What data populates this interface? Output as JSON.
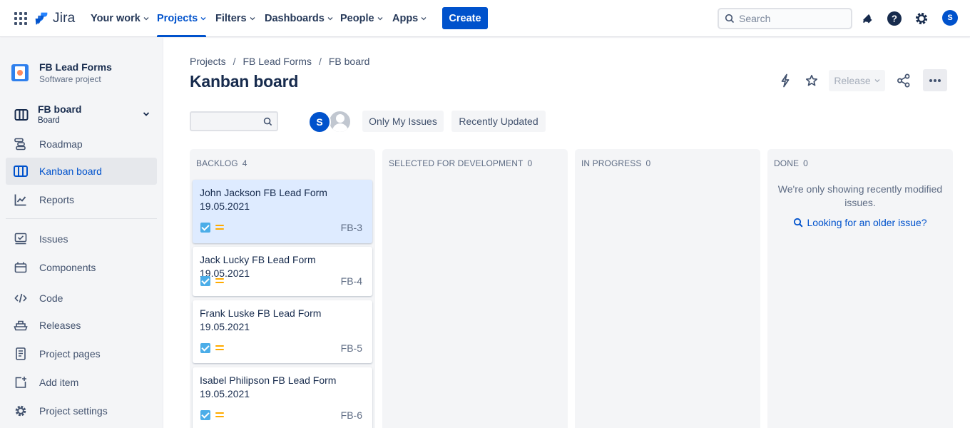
{
  "topnav": {
    "logo_text": "Jira",
    "items": [
      {
        "label": "Your work"
      },
      {
        "label": "Projects"
      },
      {
        "label": "Filters"
      },
      {
        "label": "Dashboards"
      },
      {
        "label": "People"
      },
      {
        "label": "Apps"
      }
    ],
    "active_item": "Projects",
    "create_label": "Create",
    "search_placeholder": "Search",
    "user_initial": "S"
  },
  "sidebar": {
    "project_name": "FB Lead Forms",
    "project_type": "Software project",
    "board_name": "FB board",
    "board_sub": "Board",
    "items": [
      {
        "label": "Roadmap",
        "icon": "roadmap-icon"
      },
      {
        "label": "Kanban board",
        "icon": "kanban-icon",
        "active": true
      },
      {
        "label": "Reports",
        "icon": "reports-icon"
      },
      {
        "label": "Issues",
        "icon": "issues-icon"
      },
      {
        "label": "Components",
        "icon": "components-icon"
      },
      {
        "label": "Code",
        "icon": "code-icon"
      },
      {
        "label": "Releases",
        "icon": "releases-icon"
      },
      {
        "label": "Project pages",
        "icon": "project-pages-icon"
      },
      {
        "label": "Add item",
        "icon": "add-item-icon"
      },
      {
        "label": "Project settings",
        "icon": "gear-icon"
      }
    ]
  },
  "main": {
    "breadcrumb": [
      "Projects",
      "FB Lead Forms",
      "FB board"
    ],
    "title": "Kanban board",
    "release_label": "Release",
    "filter_avatar_initial": "S",
    "quick_filters": [
      "Only My Issues",
      "Recently Updated"
    ],
    "columns": [
      {
        "name": "BACKLOG",
        "count": "4",
        "cards": [
          {
            "title": "John Jackson FB Lead Form 19.05.2021",
            "key": "FB-3",
            "selected": true
          },
          {
            "title": "Jack Lucky FB Lead Form 19.05.2021",
            "key": "FB-4"
          },
          {
            "title": "Frank Luske FB Lead Form 19.05.2021",
            "key": "FB-5"
          },
          {
            "title": "Isabel Philipson FB Lead Form 19.05.2021",
            "key": "FB-6"
          }
        ]
      },
      {
        "name": "SELECTED FOR DEVELOPMENT",
        "count": "0",
        "cards": []
      },
      {
        "name": "IN PROGRESS",
        "count": "0",
        "cards": []
      },
      {
        "name": "DONE",
        "count": "0",
        "cards": [],
        "message": "We're only showing recently modified issues.",
        "link": "Looking for an older issue?"
      }
    ]
  },
  "colors": {
    "brand_blue": "#0052cc",
    "sidebar_bg": "#f4f5f7",
    "selected_card": "#deebff",
    "task_icon": "#4bade8",
    "priority_medium": "#ffab00"
  }
}
